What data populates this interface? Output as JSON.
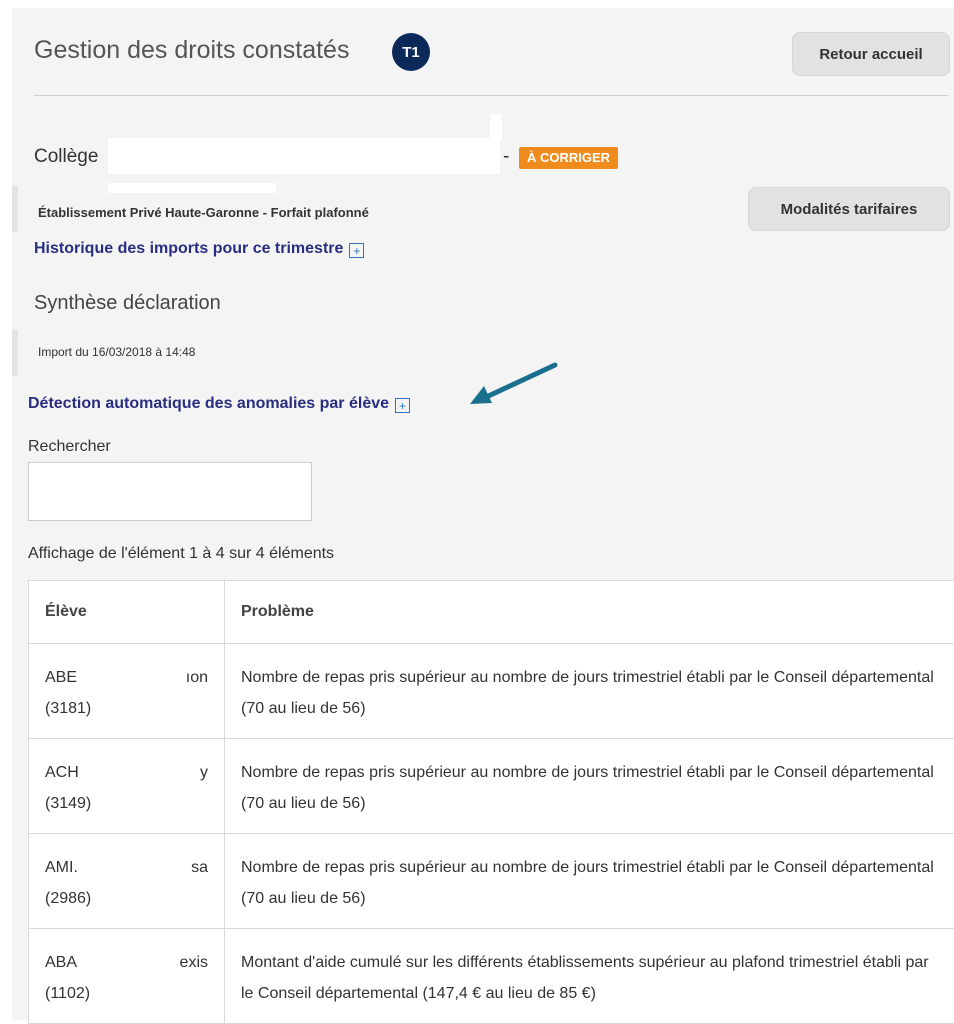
{
  "header": {
    "title": "Gestion des droits constatés",
    "badge": "T1",
    "home_button": "Retour accueil"
  },
  "school": {
    "label": "Collège",
    "dash": "-",
    "status": "À CORRIGER",
    "establishment": "Établissement Privé Haute-Garonne - Forfait plafonné",
    "tariff_button": "Modalités tarifaires",
    "history_link": "Historique des imports pour ce trimestre"
  },
  "synthesis": {
    "title": "Synthèse déclaration",
    "import_info": "Import du 16/03/2018 à 14:48",
    "detection_link": "Détection automatique des anomalies par élève"
  },
  "search": {
    "label": "Rechercher",
    "value": "",
    "placeholder": ""
  },
  "table": {
    "info": "Affichage de l'élément 1 à 4 sur 4 éléments",
    "columns": [
      "Élève",
      "Problème"
    ],
    "rows": [
      {
        "student_start": "ABE",
        "student_end": "ıon",
        "student_id": "(3181)",
        "problem": "Nombre de repas pris supérieur au nombre de jours trimestriel établi par le Conseil départemental (70 au lieu de 56)"
      },
      {
        "student_start": "ACH",
        "student_end": "y",
        "student_id": "(3149)",
        "problem": "Nombre de repas pris supérieur au nombre de jours trimestriel établi par le Conseil départemental (70 au lieu de 56)"
      },
      {
        "student_start": "AMI.",
        "student_end": "sa",
        "student_id": "(2986)",
        "problem": "Nombre de repas pris supérieur au nombre de jours trimestriel établi par le Conseil départemental (70 au lieu de 56)"
      },
      {
        "student_start": "ABA",
        "student_end": "exis",
        "student_id": "(1102)",
        "problem": "Montant d'aide cumulé sur les différents établissements supérieur au plafond trimestriel établi par le Conseil départemental (147,4 € au lieu de 85 €)"
      }
    ]
  },
  "icons": {
    "plus": "+",
    "annotation": "arrow-icon"
  },
  "colors": {
    "badge": "#0b2a5a",
    "status": "#f08c1e",
    "link": "#2a2e80",
    "arrow": "#1a6e8e"
  }
}
